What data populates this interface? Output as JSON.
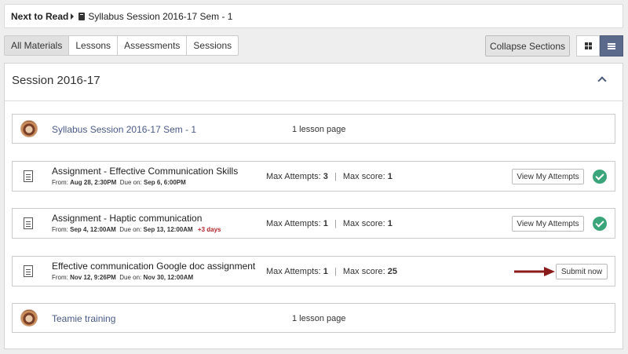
{
  "next_to_read": {
    "label": "Next to Read",
    "item": "Syllabus Session 2016-17 Sem - 1"
  },
  "tabs": [
    "All Materials",
    "Lessons",
    "Assessments",
    "Sessions"
  ],
  "active_tab": "All Materials",
  "collapse_label": "Collapse Sections",
  "view_mode": "list",
  "session": {
    "title": "Session 2016-17",
    "items": [
      {
        "type": "lesson",
        "title": "Syllabus Session 2016-17 Sem - 1",
        "pages": "1 lesson page"
      },
      {
        "type": "assignment",
        "title": "Assignment - Effective Communication Skills",
        "from_label": "From:",
        "from": "Aug 28, 2:30PM",
        "due_label": "Due on:",
        "due": "Sep 6, 6:00PM",
        "late": "",
        "attempts_label": "Max Attempts:",
        "attempts": "3",
        "score_label": "Max score:",
        "score": "1",
        "action": "View My Attempts",
        "completed": true
      },
      {
        "type": "assignment",
        "title": "Assignment - Haptic communication",
        "from_label": "From:",
        "from": "Sep 4, 12:00AM",
        "due_label": "Due on:",
        "due": "Sep 13, 12:00AM",
        "late": "+3 days",
        "attempts_label": "Max Attempts:",
        "attempts": "1",
        "score_label": "Max score:",
        "score": "1",
        "action": "View My Attempts",
        "completed": true
      },
      {
        "type": "assignment",
        "title": "Effective communication Google doc assignment",
        "from_label": "From:",
        "from": "Nov 12, 9:26PM",
        "due_label": "Due on:",
        "due": "Nov 30, 12:00AM",
        "late": "",
        "attempts_label": "Max Attempts:",
        "attempts": "1",
        "score_label": "Max score:",
        "score": "25",
        "action": "Submit now",
        "completed": false
      },
      {
        "type": "lesson",
        "title": "Teamie training",
        "pages": "1 lesson page"
      }
    ]
  },
  "colors": {
    "accent": "#4a5a86",
    "success": "#3aa57a",
    "late": "#b0262b",
    "arrow": "#8b1a1a"
  }
}
